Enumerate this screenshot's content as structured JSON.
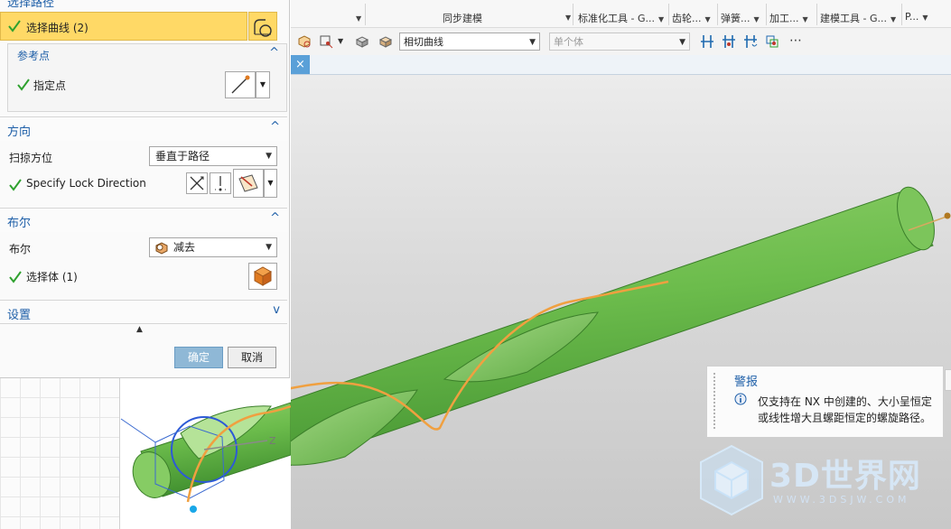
{
  "ribbon": {
    "groups": [
      "同步建模",
      "标准化工具 - G...",
      "齿轮...",
      "弹簧...",
      "加工...",
      "建模工具 - G...",
      "P..."
    ]
  },
  "toolbar": {
    "curve_rule_value": "相切曲线",
    "body_filter_value": "单个体"
  },
  "dialog": {
    "path_section_title": "选择路径",
    "select_curve_label": "选择曲线 (2)",
    "ref_point": {
      "title": "参考点",
      "specify_point_label": "指定点"
    },
    "direction": {
      "title": "方向",
      "sweep_orient_label": "扫掠方位",
      "sweep_orient_value": "垂直于路径",
      "lock_dir_label": "Specify Lock Direction"
    },
    "boolean": {
      "title": "布尔",
      "label": "布尔",
      "value": "减去",
      "select_body_label": "选择体 (1)"
    },
    "settings": {
      "title": "设置"
    },
    "ok_label": "确定",
    "cancel_label": "取消"
  },
  "alert": {
    "title": "警报",
    "message": "仅支持在 NX 中创建的、大小呈恒定或线性增大且螺距恒定的螺旋路径。"
  },
  "viewport": {
    "axis_label": "Z"
  },
  "watermark": {
    "brand": "3D世界网",
    "url": "WWW.3DSJW.COM"
  },
  "colors": {
    "accent_blue": "#1e5fa8",
    "highlight_yellow": "#ffd966",
    "check_green": "#2fa12f",
    "model_green": "#6fbf50",
    "path_orange": "#f0a040",
    "ok_button": "#8fb8d6"
  }
}
